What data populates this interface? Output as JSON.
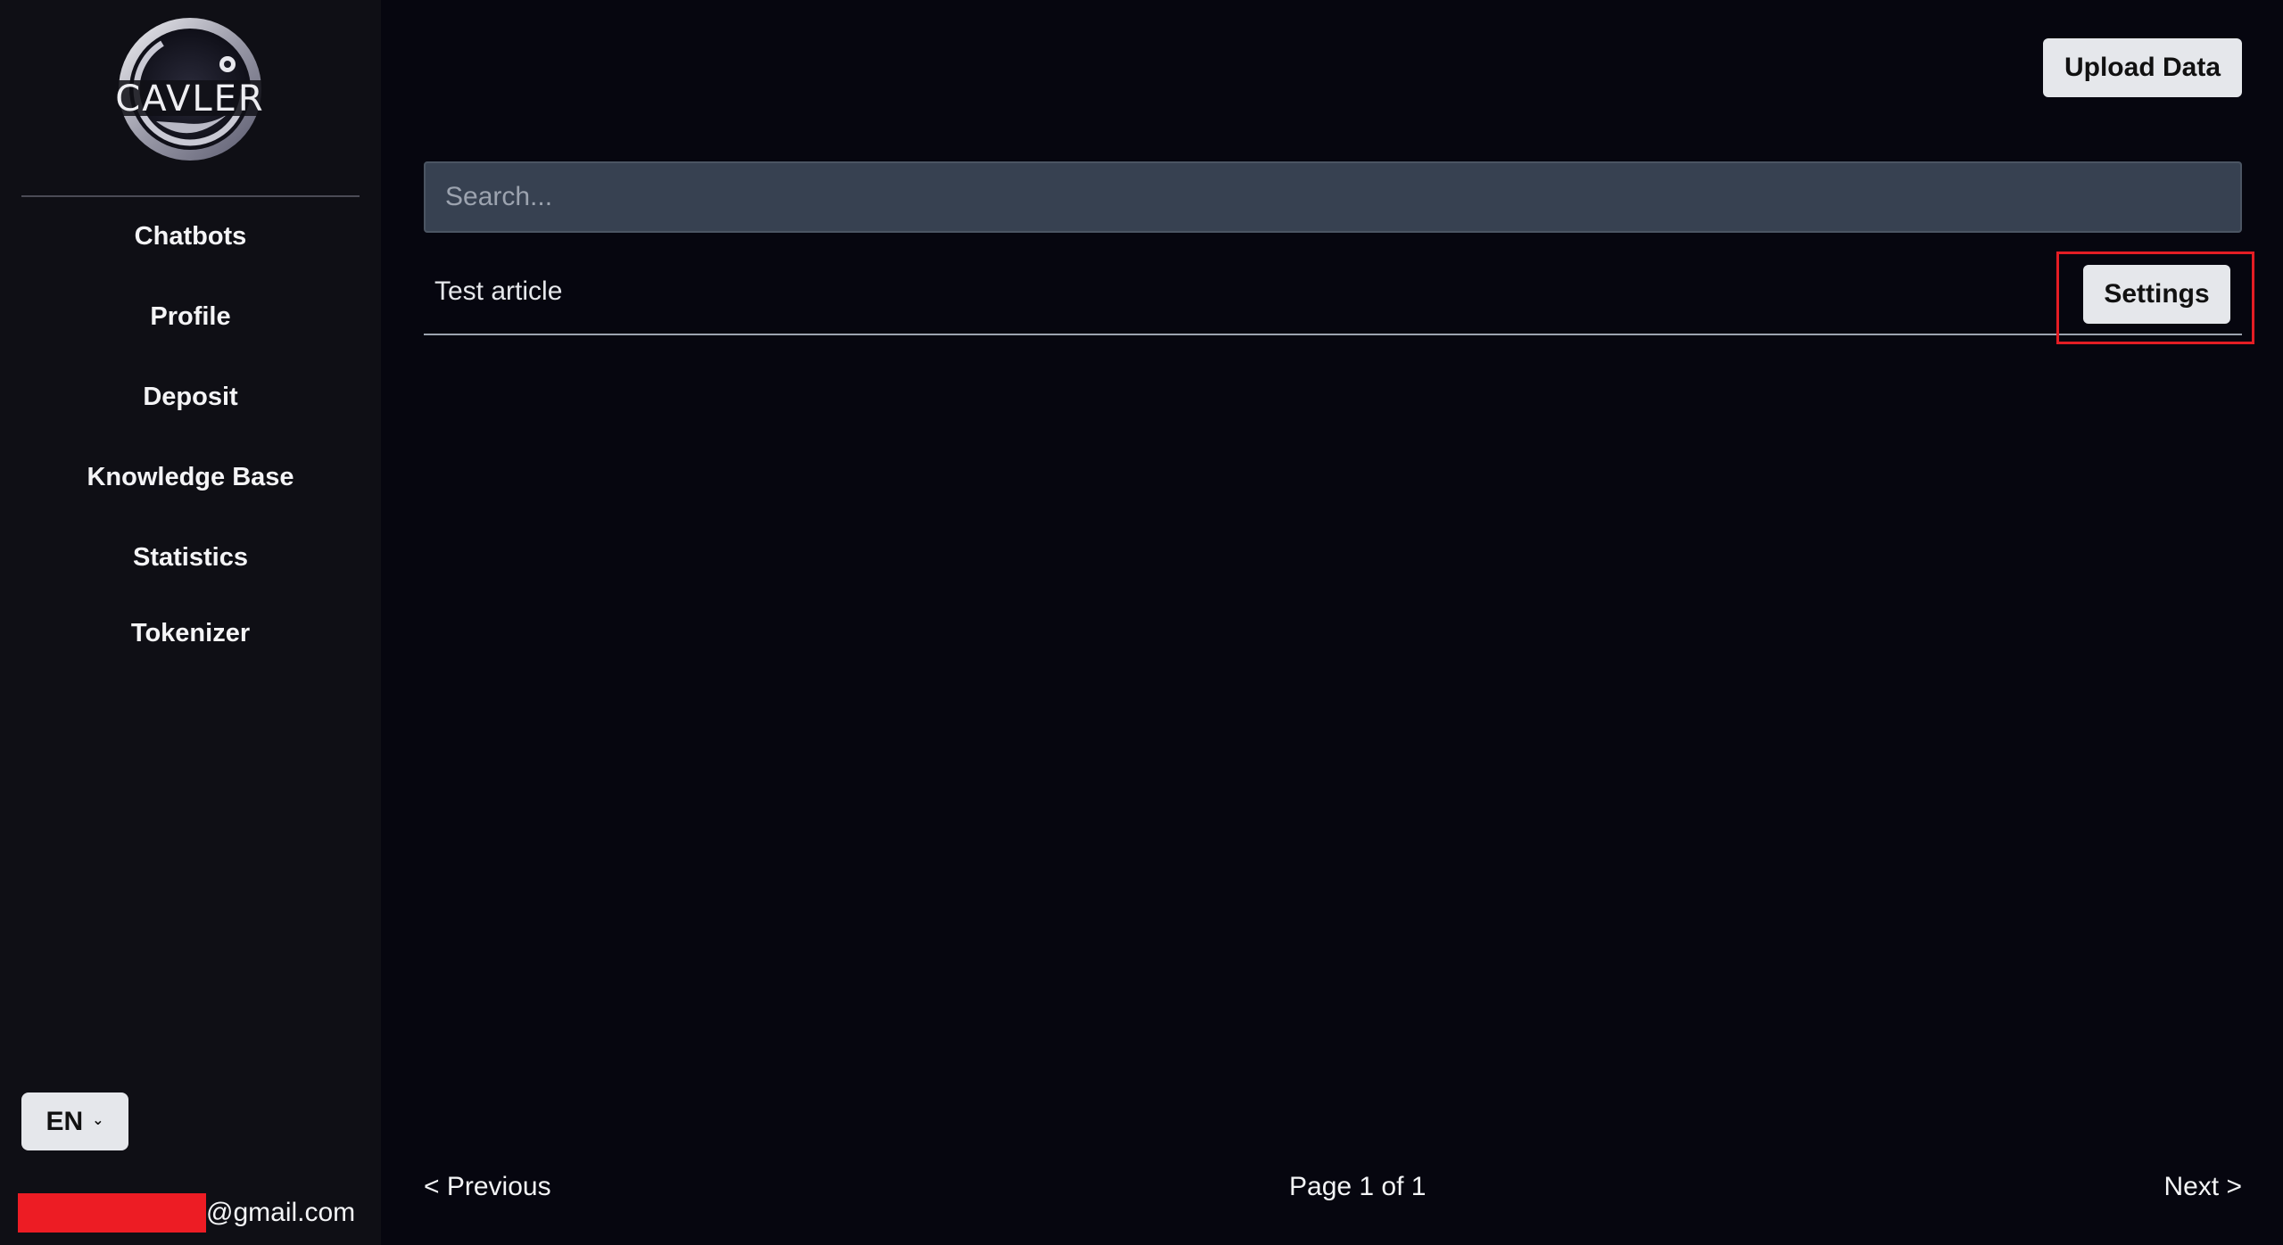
{
  "brand": {
    "logo_text": "CAVLER"
  },
  "sidebar": {
    "items": [
      {
        "label": "Chatbots"
      },
      {
        "label": "Profile"
      },
      {
        "label": "Deposit"
      },
      {
        "label": "Knowledge Base"
      },
      {
        "label": "Statistics"
      },
      {
        "label": "Tokenizer"
      }
    ],
    "language": {
      "selected": "EN"
    },
    "user_email_suffix": "@gmail.com"
  },
  "toolbar": {
    "upload_label": "Upload Data"
  },
  "search": {
    "placeholder": "Search...",
    "value": ""
  },
  "articles": [
    {
      "title": "Test article",
      "action_label": "Settings"
    }
  ],
  "pagination": {
    "prev_label": "< Previous",
    "page_label": "Page 1 of 1",
    "next_label": "Next >"
  },
  "colors": {
    "background": "#06060f",
    "sidebar": "#0f0f15",
    "search_field": "#374151",
    "button": "#e5e7eb",
    "highlight": "#e41d24",
    "redaction": "#ed1c24"
  }
}
